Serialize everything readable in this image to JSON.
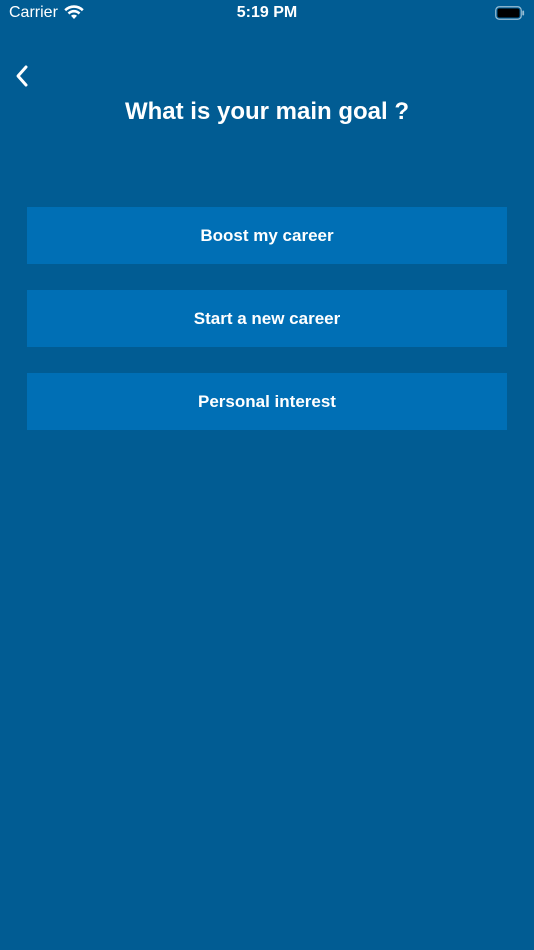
{
  "status_bar": {
    "carrier": "Carrier",
    "time": "5:19 PM",
    "wifi_icon": "wifi-icon",
    "battery_icon": "battery-icon"
  },
  "nav": {
    "back_icon": "chevron-left-icon"
  },
  "title": "What is your main goal ?",
  "options": [
    {
      "label": "Boost my career"
    },
    {
      "label": "Start a new career"
    },
    {
      "label": "Personal interest"
    }
  ],
  "colors": {
    "background": "#015c93",
    "button": "#006fb5",
    "text": "#ffffff"
  }
}
